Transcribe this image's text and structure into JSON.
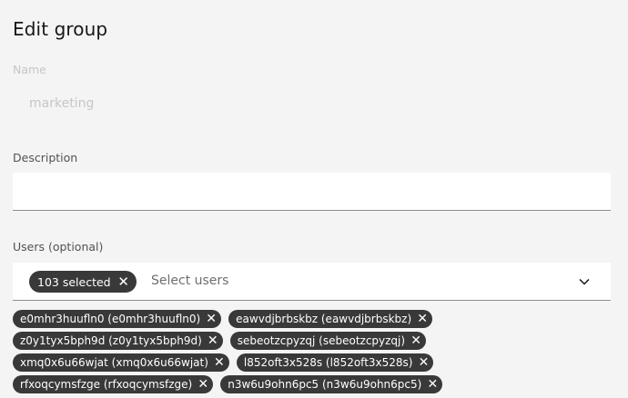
{
  "page": {
    "title": "Edit group"
  },
  "name": {
    "label": "Name",
    "value": "marketing"
  },
  "description": {
    "label": "Description",
    "value": ""
  },
  "users": {
    "label": "Users (optional)",
    "selected_count": "103 selected",
    "placeholder": "Select users",
    "tag_rows": [
      [
        "e0mhr3huufln0 (e0mhr3huufln0)",
        "eawvdjbrbskbz (eawvdjbrbskbz)"
      ],
      [
        "z0y1tyx5bph9d (z0y1tyx5bph9d)",
        "sebeotzcpyzqj (sebeotzcpyzqj)"
      ],
      [
        "xmq0x6u66wjat (xmq0x6u66wjat)",
        "l852oft3x528s (l852oft3x528s)"
      ],
      [
        "rfxoqcymsfzge (rfxoqcymsfzge)",
        "n3w6u9ohn6pc5 (n3w6u9ohn6pc5)"
      ]
    ]
  },
  "icons": {
    "remove": "close-icon",
    "expand": "chevron-down-icon"
  }
}
